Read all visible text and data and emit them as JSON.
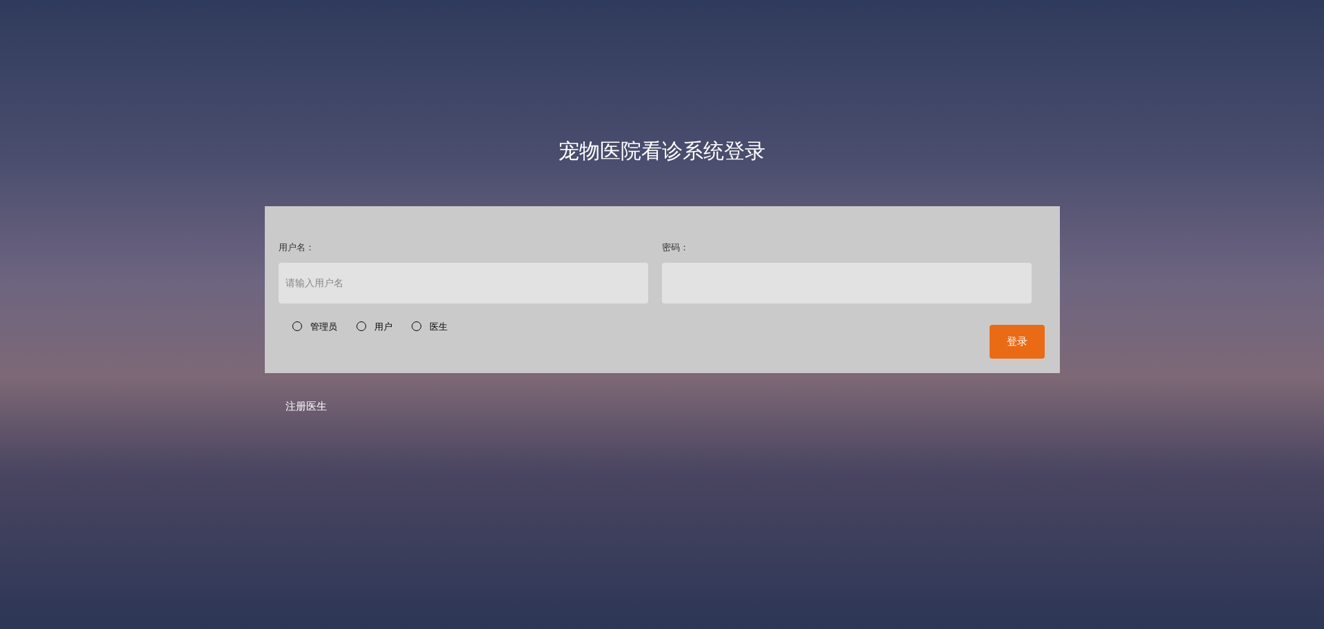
{
  "title": "宠物医院看诊系统登录",
  "form": {
    "username": {
      "label": "用户名：",
      "placeholder": "请输入用户名"
    },
    "password": {
      "label": "密码："
    },
    "roles": [
      {
        "label": "管理员",
        "selected": false
      },
      {
        "label": "用户",
        "selected": false
      },
      {
        "label": "医生",
        "selected": false
      }
    ],
    "login_button": "登录"
  },
  "register_link": "注册医生"
}
